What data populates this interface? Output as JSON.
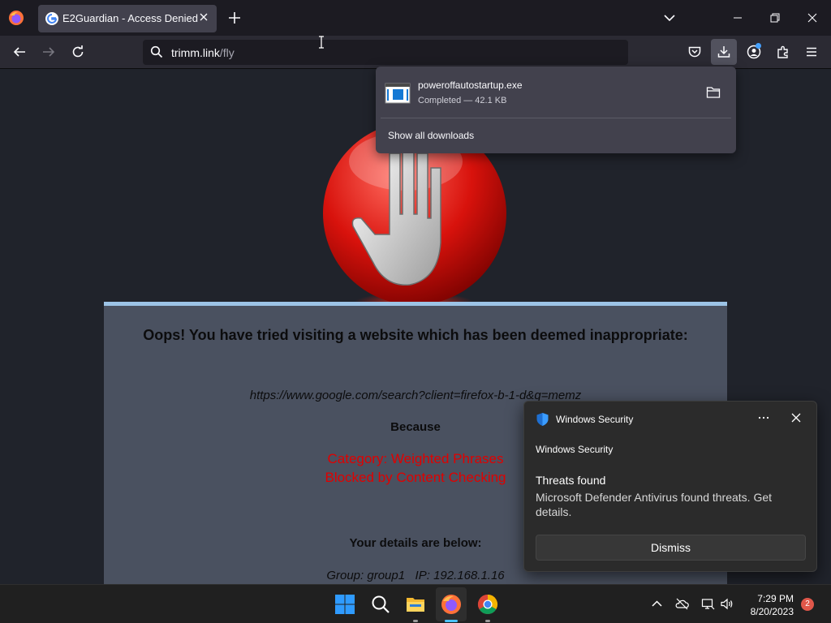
{
  "browser": {
    "tab": {
      "title": "E2Guardian - Access Denied",
      "favicon": "google-g-icon"
    },
    "url": {
      "host": "trimm.link",
      "path": "/fly"
    },
    "downloads": {
      "file_name": "poweroffautostartup.exe",
      "status": "Completed — 42.1 KB",
      "show_all": "Show all downloads"
    }
  },
  "page": {
    "heading": "Oops! You have tried visiting a website which has been deemed inappropriate:",
    "blocked_url": "https://www.google.com/search?client=firefox-b-1-d&q=memz",
    "because": "Because",
    "category_line1": "Category: Weighted Phrases",
    "category_line2": "Blocked by Content Checking",
    "details_title": "Your details are below:",
    "details": "Group: group1   IP: 192.168.1.16"
  },
  "toast": {
    "app": "Windows Security",
    "subtitle": "Windows Security",
    "title": "Threats found",
    "body": "Microsoft Defender Antivirus found threats. Get details.",
    "dismiss": "Dismiss"
  },
  "taskbar": {
    "time": "7:29 PM",
    "date": "8/20/2023",
    "notification_count": "2"
  },
  "colors": {
    "accent_blue": "#45a1ff",
    "blocked_red": "#e00000",
    "panel_bg": "#4a5160",
    "page_bg": "#20232b"
  }
}
